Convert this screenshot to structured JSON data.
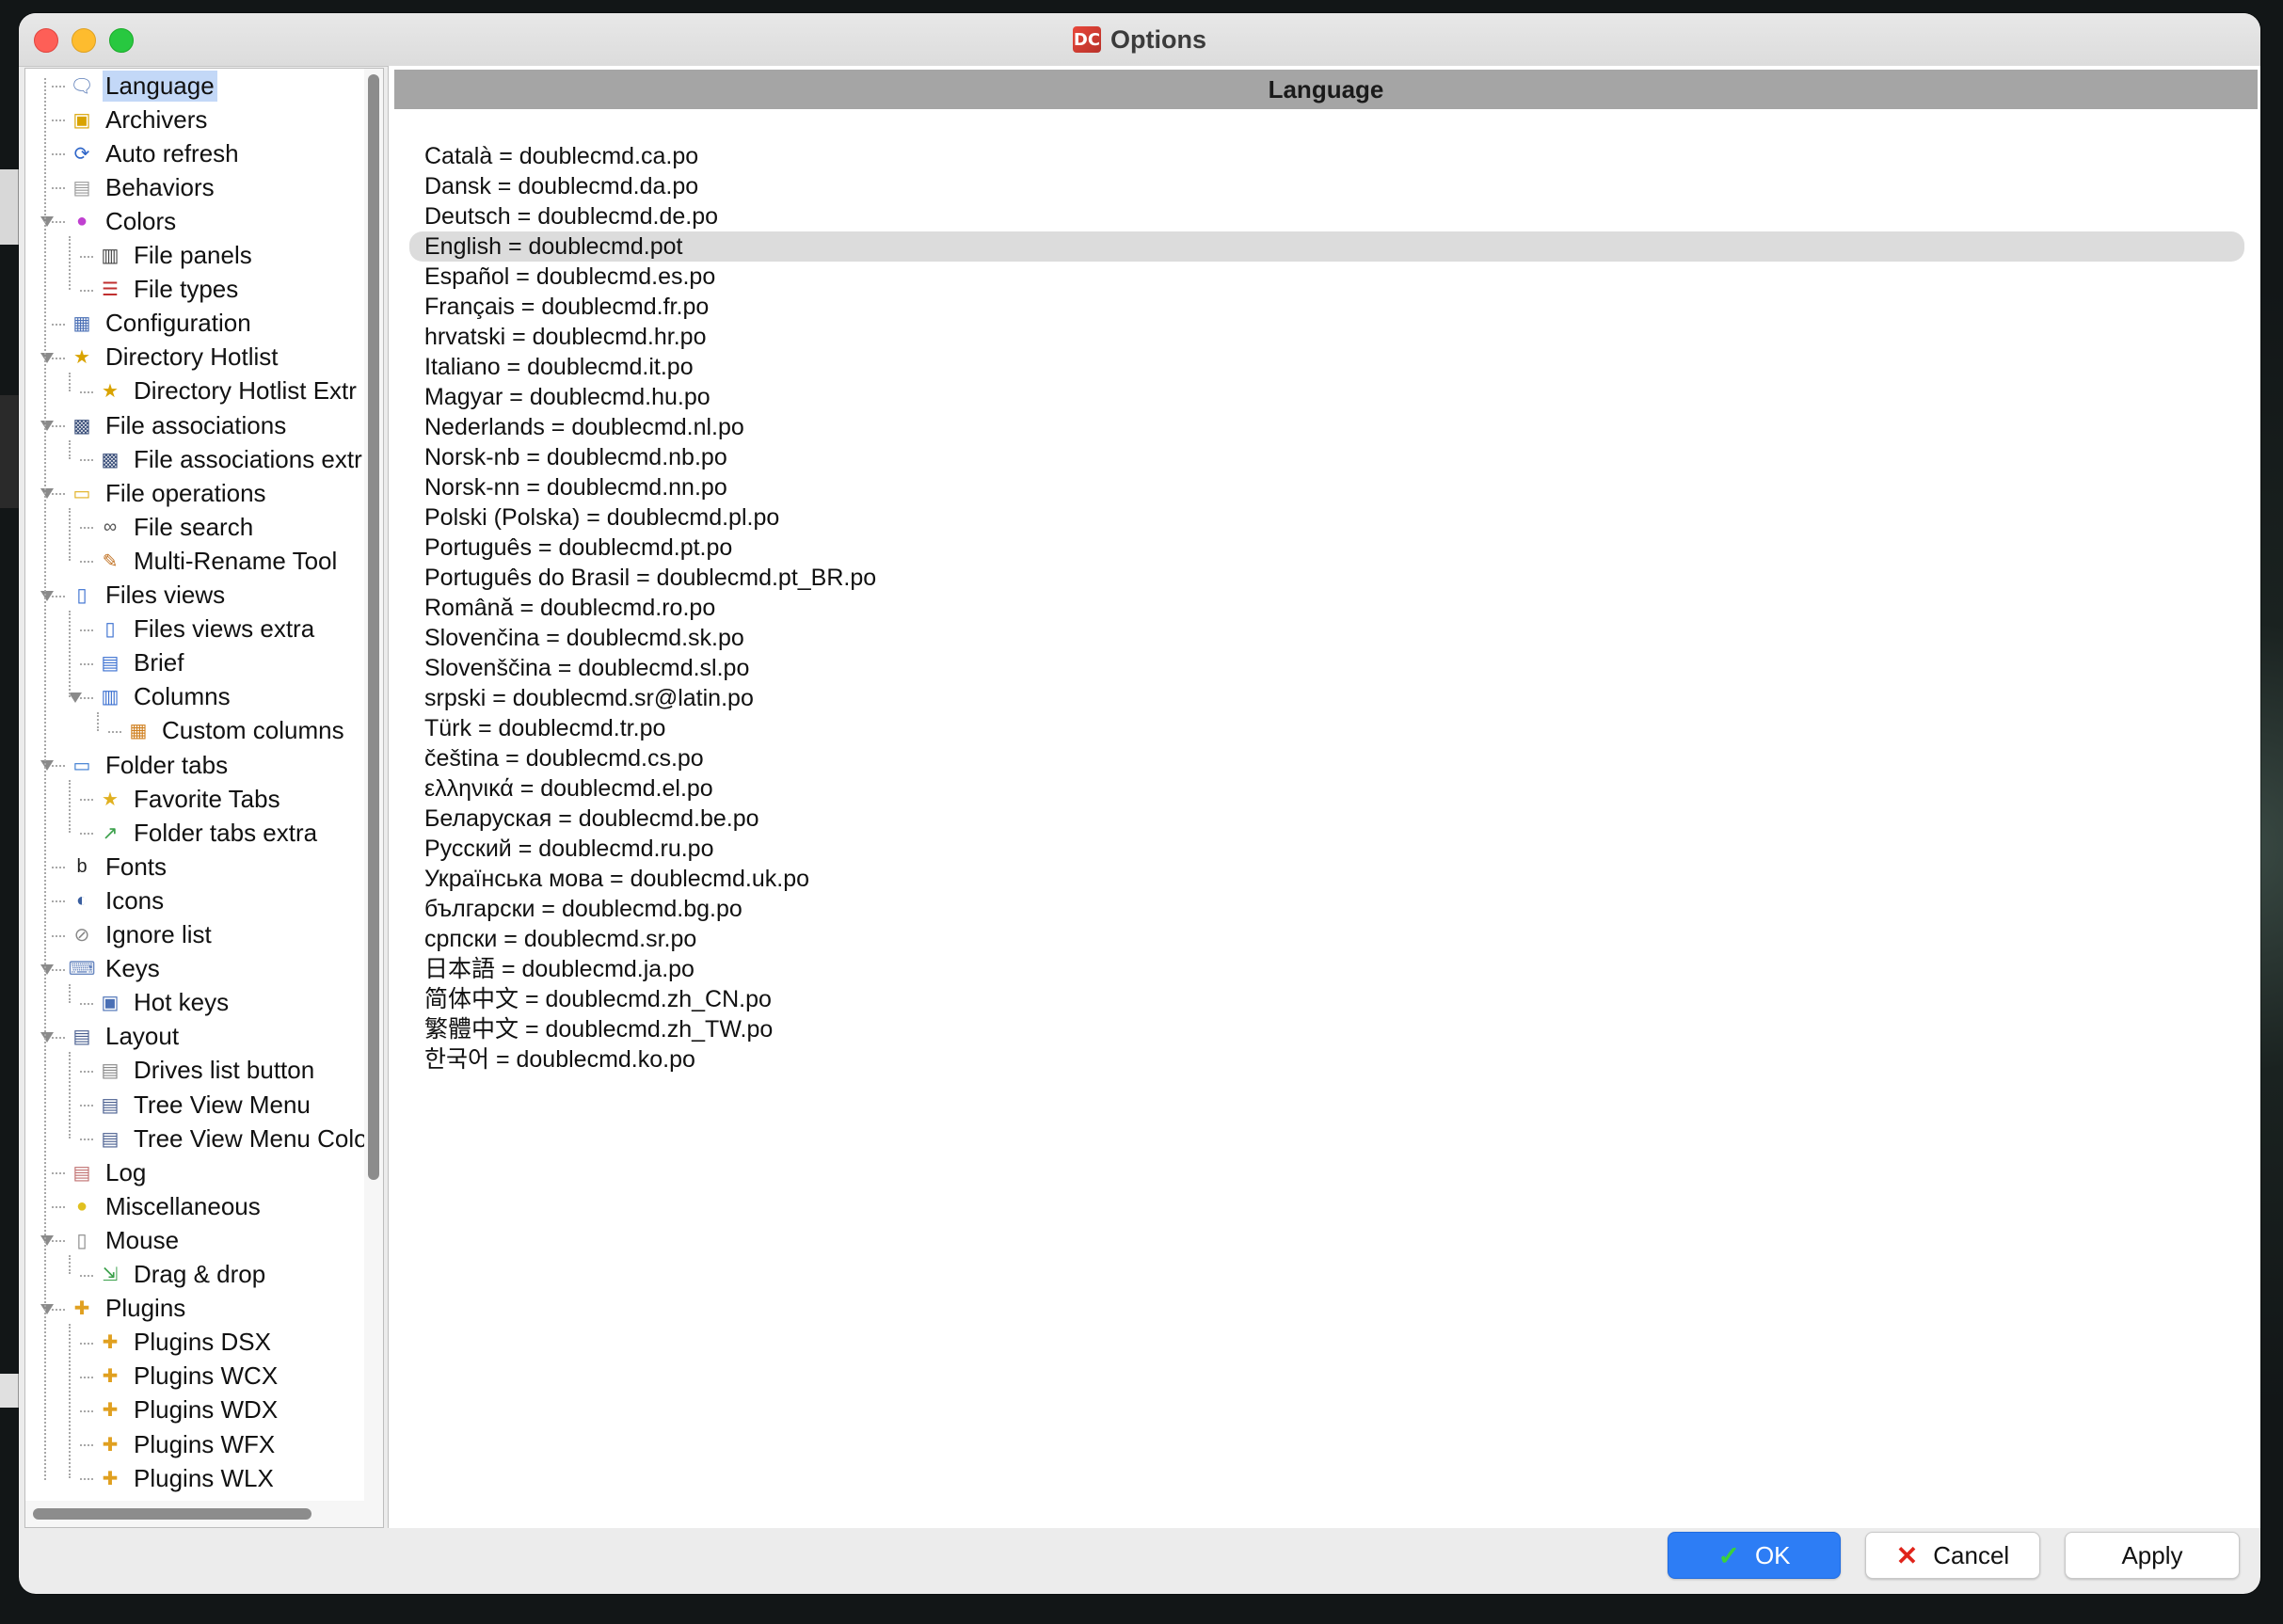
{
  "window": {
    "title": "Options",
    "app_icon_text": "DC"
  },
  "colors": {
    "selection": "#c3d8f7",
    "header_bg": "#a5a5a5",
    "ok_button": "#2d7df5",
    "list_selection": "#dcdcdc"
  },
  "tree": {
    "items": [
      {
        "label": "Language",
        "level": 0,
        "icon": "language-icon",
        "selected": true
      },
      {
        "label": "Archivers",
        "level": 0,
        "icon": "archive-icon"
      },
      {
        "label": "Auto refresh",
        "level": 0,
        "icon": "refresh-icon"
      },
      {
        "label": "Behaviors",
        "level": 0,
        "icon": "lock-icon"
      },
      {
        "label": "Colors",
        "level": 0,
        "icon": "color-wheel-icon",
        "expanded": true
      },
      {
        "label": "File panels",
        "level": 1,
        "icon": "file-panels-icon"
      },
      {
        "label": "File types",
        "level": 1,
        "icon": "file-types-icon"
      },
      {
        "label": "Configuration",
        "level": 0,
        "icon": "configuration-icon"
      },
      {
        "label": "Directory Hotlist",
        "level": 0,
        "icon": "folder-star-icon",
        "expanded": true
      },
      {
        "label": "Directory Hotlist Extr",
        "level": 1,
        "icon": "folder-star-icon"
      },
      {
        "label": "File associations",
        "level": 0,
        "icon": "file-associations-icon",
        "expanded": true
      },
      {
        "label": "File associations extr",
        "level": 1,
        "icon": "file-associations-icon"
      },
      {
        "label": "File operations",
        "level": 0,
        "icon": "folder-open-icon",
        "expanded": true
      },
      {
        "label": "File search",
        "level": 1,
        "icon": "binoculars-icon"
      },
      {
        "label": "Multi-Rename Tool",
        "level": 1,
        "icon": "rename-icon"
      },
      {
        "label": "Files views",
        "level": 0,
        "icon": "files-views-icon",
        "expanded": true
      },
      {
        "label": "Files views extra",
        "level": 1,
        "icon": "files-views-icon"
      },
      {
        "label": "Brief",
        "level": 1,
        "icon": "brief-icon"
      },
      {
        "label": "Columns",
        "level": 1,
        "icon": "columns-icon",
        "expanded": true
      },
      {
        "label": "Custom columns",
        "level": 2,
        "icon": "custom-columns-icon"
      },
      {
        "label": "Folder tabs",
        "level": 0,
        "icon": "folder-tabs-icon",
        "expanded": true
      },
      {
        "label": "Favorite Tabs",
        "level": 1,
        "icon": "favorite-tabs-icon"
      },
      {
        "label": "Folder tabs extra",
        "level": 1,
        "icon": "chart-icon"
      },
      {
        "label": "Fonts",
        "level": 0,
        "icon": "fonts-icon"
      },
      {
        "label": "Icons",
        "level": 0,
        "icon": "icons-icon"
      },
      {
        "label": "Ignore list",
        "level": 0,
        "icon": "ignore-list-icon"
      },
      {
        "label": "Keys",
        "level": 0,
        "icon": "keyboard-icon",
        "expanded": true
      },
      {
        "label": "Hot keys",
        "level": 1,
        "icon": "hot-keys-icon"
      },
      {
        "label": "Layout",
        "level": 0,
        "icon": "layout-icon",
        "expanded": true
      },
      {
        "label": "Drives list button",
        "level": 1,
        "icon": "drives-icon"
      },
      {
        "label": "Tree View Menu",
        "level": 1,
        "icon": "tree-view-icon"
      },
      {
        "label": "Tree View Menu Colo",
        "level": 1,
        "icon": "tree-view-icon"
      },
      {
        "label": "Log",
        "level": 0,
        "icon": "log-icon"
      },
      {
        "label": "Miscellaneous",
        "level": 0,
        "icon": "misc-icon"
      },
      {
        "label": "Mouse",
        "level": 0,
        "icon": "mouse-icon",
        "expanded": true
      },
      {
        "label": "Drag & drop",
        "level": 1,
        "icon": "drag-drop-icon"
      },
      {
        "label": "Plugins",
        "level": 0,
        "icon": "plugin-icon",
        "expanded": true
      },
      {
        "label": "Plugins DSX",
        "level": 1,
        "icon": "plugin-icon"
      },
      {
        "label": "Plugins WCX",
        "level": 1,
        "icon": "plugin-icon"
      },
      {
        "label": "Plugins WDX",
        "level": 1,
        "icon": "plugin-icon"
      },
      {
        "label": "Plugins WFX",
        "level": 1,
        "icon": "plugin-icon"
      },
      {
        "label": "Plugins WLX",
        "level": 1,
        "icon": "plugin-icon"
      }
    ]
  },
  "content": {
    "header": "Language",
    "languages": [
      "Català = doublecmd.ca.po",
      "Dansk = doublecmd.da.po",
      "Deutsch = doublecmd.de.po",
      "English = doublecmd.pot",
      "Español = doublecmd.es.po",
      "Français = doublecmd.fr.po",
      "hrvatski = doublecmd.hr.po",
      "Italiano = doublecmd.it.po",
      "Magyar = doublecmd.hu.po",
      "Nederlands = doublecmd.nl.po",
      "Norsk-nb = doublecmd.nb.po",
      "Norsk-nn = doublecmd.nn.po",
      "Polski (Polska) = doublecmd.pl.po",
      "Português = doublecmd.pt.po",
      "Português do Brasil = doublecmd.pt_BR.po",
      "Română = doublecmd.ro.po",
      "Slovenčina = doublecmd.sk.po",
      "Slovenščina = doublecmd.sl.po",
      "srpski = doublecmd.sr@latin.po",
      "Türk = doublecmd.tr.po",
      "čeština = doublecmd.cs.po",
      "ελληνικά = doublecmd.el.po",
      "Беларуская = doublecmd.be.po",
      "Русский = doublecmd.ru.po",
      "Українська мова = doublecmd.uk.po",
      "български = doublecmd.bg.po",
      "српски = doublecmd.sr.po",
      "日本語 = doublecmd.ja.po",
      "简体中文 = doublecmd.zh_CN.po",
      "繁體中文 = doublecmd.zh_TW.po",
      "한국어 = doublecmd.ko.po"
    ],
    "selected_index": 3
  },
  "buttons": {
    "ok": "OK",
    "cancel": "Cancel",
    "apply": "Apply"
  }
}
